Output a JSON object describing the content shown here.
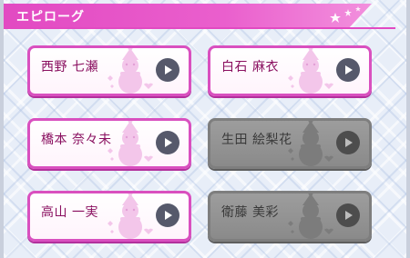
{
  "header": {
    "title": "エピローグ"
  },
  "epilogues": [
    {
      "name": "西野 七瀬",
      "unlocked": true
    },
    {
      "name": "白石 麻衣",
      "unlocked": true
    },
    {
      "name": "橋本 奈々未",
      "unlocked": true
    },
    {
      "name": "生田 絵梨花",
      "unlocked": false
    },
    {
      "name": "高山 一実",
      "unlocked": true
    },
    {
      "name": "衛藤 美彩",
      "unlocked": false
    }
  ],
  "icons": {
    "play": "play-icon",
    "decoration": "snowman-icon",
    "header_ornament": "star-icon"
  },
  "colors": {
    "accent": "#e24ac2",
    "card_border": "#d950bf",
    "locked": "#8a8a8a",
    "play_button": "#56596b"
  }
}
